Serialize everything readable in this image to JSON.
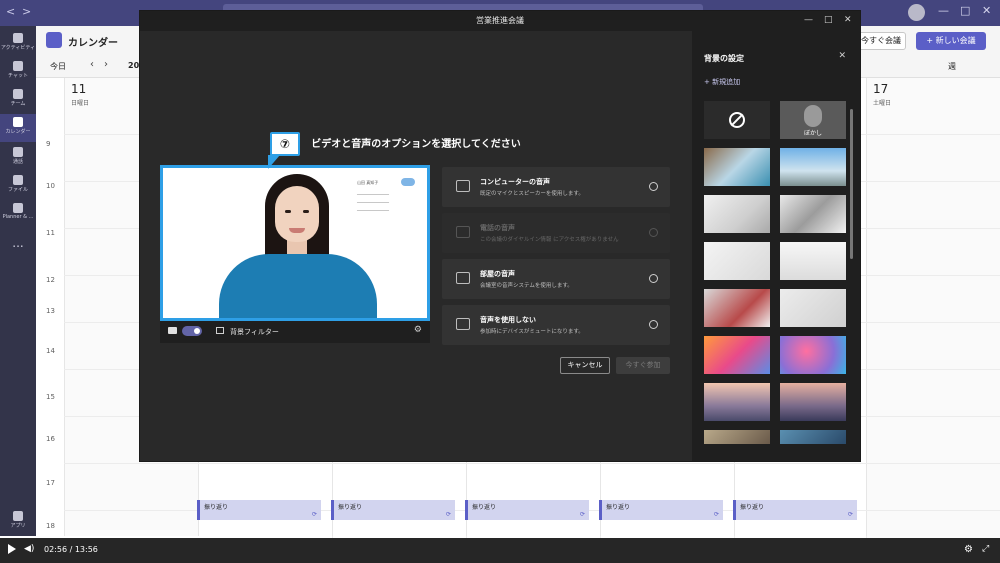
{
  "calendar": {
    "title": "カレンダー",
    "meet_now": "今すぐ会議",
    "new_meeting": "+ 新しい会議",
    "today": "今日",
    "month_partial": "202",
    "view": "週",
    "days": [
      {
        "num": "11",
        "name": "日曜日"
      },
      {
        "num": "17",
        "name": "土曜日"
      }
    ],
    "hours": [
      "9",
      "10",
      "11",
      "12",
      "13",
      "14",
      "15",
      "16",
      "17",
      "18"
    ],
    "event_label": "振り返り",
    "repeat_icon": "repeat-icon"
  },
  "rail": {
    "items": [
      {
        "label": "アクティビティ"
      },
      {
        "label": "チャット"
      },
      {
        "label": "チーム"
      },
      {
        "label": "カレンダー"
      },
      {
        "label": "通話"
      },
      {
        "label": "ファイル"
      },
      {
        "label": "Planner & ..."
      }
    ],
    "more": "...",
    "apps": "アプリ"
  },
  "modal": {
    "title": "営業推進会議",
    "heading": "ビデオと音声のオプションを選択してください",
    "callout": "⑦",
    "bg_filter": "背景フィルター",
    "card_lines": [
      "山田 真知子",
      "________________",
      "________________",
      "________________"
    ],
    "options": [
      {
        "title": "コンピューターの音声",
        "desc": "既定のマイクとスピーカーを使用します。",
        "disabled": false
      },
      {
        "title": "電話の音声",
        "desc": "この会議のダイヤルイン情報 にアクセス権がありません",
        "disabled": true
      },
      {
        "title": "部屋の音声",
        "desc": "会議室の音声システムを使用します。",
        "disabled": false
      },
      {
        "title": "音声を使用しない",
        "desc": "参加時にデバイスがミュートになります。",
        "disabled": false
      }
    ],
    "cancel": "キャンセル",
    "join": "今すぐ参加"
  },
  "bg_panel": {
    "title": "背景の設定",
    "add_new": "+ 新規追加",
    "blur": "ぼかし"
  },
  "player": {
    "time": "02:56 / 13:56",
    "progress": 0.213
  },
  "colors": {
    "accent": "#5b5fc7",
    "highlight": "#2e9fe6"
  }
}
